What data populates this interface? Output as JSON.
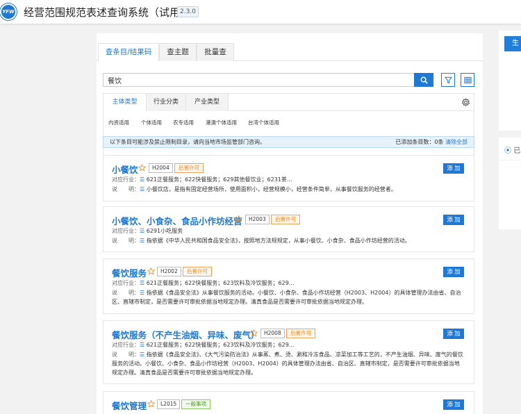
{
  "app": {
    "logo_text": "YFW",
    "title": "经营范围规范表述查询系统（试用版）",
    "version": "2.3.0"
  },
  "main_tabs": [
    {
      "label": "查条目/结果码",
      "active": true
    },
    {
      "label": "查主题",
      "active": false
    },
    {
      "label": "批量查",
      "active": false
    }
  ],
  "search": {
    "value": "餐饮",
    "placeholder": ""
  },
  "filter_tabs": [
    {
      "label": "主体类型",
      "active": true
    },
    {
      "label": "行业分类",
      "active": false
    },
    {
      "label": "产业类型",
      "active": false
    }
  ],
  "categories": [
    "内资适用",
    "个体适用",
    "农专适用",
    "港澳个体适用",
    "台湾个体适用"
  ],
  "notice": {
    "left": "以下条目可能涉及禁止限制目录，请向当地市场监管部门咨询。",
    "right": "已添加条目数：0条",
    "clear": "清除全部"
  },
  "labels": {
    "industry": "对应行业：",
    "desc": "说　　明："
  },
  "add_label": "添 加",
  "results": [
    {
      "title": "小餐饮",
      "code": "H2004",
      "type": "后置许可",
      "type_color": "orange",
      "industry": "621正餐服务；622快餐服务；629其他餐饮业；6231茶...",
      "desc": "小餐饮店，是指有固定经营场所，使用面积小，经营规模小，经营条件简单，从事餐饮服务的经营者。"
    },
    {
      "title": "小餐饮、小食杂、食品小作坊经营",
      "code": "H2003",
      "type": "后置许可",
      "type_color": "orange",
      "industry": "6291小吃服务",
      "desc": "指依据《中华人民共和国食品安全法》，按照地方法规规定，从事小餐饮、小食杂、食品小作坊经营的活动。"
    },
    {
      "title": "餐饮服务",
      "code": "H2002",
      "type": "后置许可",
      "type_color": "orange",
      "industry": "621正餐服务；622快餐服务；623饮料及冷饮服务；629...",
      "desc": "指依据《食品安全法》从事餐饮服务的活动。小餐饮、小食杂、食品小作坊经营（H2003、H2004）的具体管理办法由省、自治区、直辖市制定，是否需要许可审批依据当地规定办理。清真食品是否需要许可审批依据当地规定办理。"
    },
    {
      "title": "餐饮服务（不产生油烟、异味、废气）",
      "code": "H2008",
      "type": "后置许可",
      "type_color": "orange",
      "industry": "621正餐服务；622快餐服务；623饮料及冷饮服务；629...",
      "desc": "指依据《食品安全法》、《大气污染防治法》从事蒸、煮、烫、涮和冷冻食品、凉菜加工等工艺的，不产生油烟、异味、废气的餐饮服务的活动。小餐饮、小食杂、食品小作坊经营（H2003、H2004）的具体管理办法由省、自治区、直辖市制定，是否需要许可审批依据当地规定办理。清真食品是否需要许可审批依据当地规定办理。"
    },
    {
      "title": "餐饮管理",
      "code": "L2015",
      "type": "一般事项",
      "type_color": "green",
      "industry": "",
      "desc": ""
    }
  ],
  "right_panel": {
    "btn_label": "生",
    "section_label": "已"
  },
  "colors": {
    "accent": "#1e78d6",
    "permit_orange": "#f08a24",
    "general_green": "#4a9a1e"
  }
}
